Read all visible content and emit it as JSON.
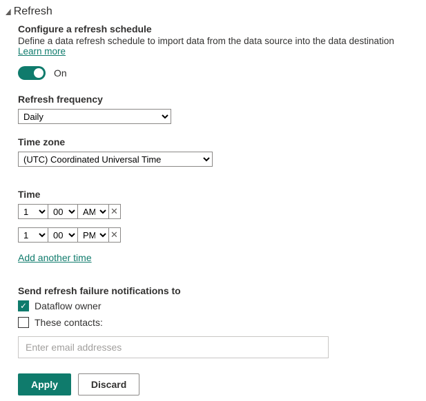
{
  "section": {
    "title": "Refresh"
  },
  "schedule": {
    "subtitle": "Configure a refresh schedule",
    "description": "Define a data refresh schedule to import data from the data source into the data destination ",
    "learn_more": "Learn more"
  },
  "toggle": {
    "state_label": "On",
    "on": true
  },
  "frequency": {
    "label": "Refresh frequency",
    "value": "Daily"
  },
  "timezone": {
    "label": "Time zone",
    "value": "(UTC) Coordinated Universal Time"
  },
  "time": {
    "label": "Time",
    "rows": [
      {
        "hour": "1",
        "minute": "00",
        "ampm": "AM"
      },
      {
        "hour": "1",
        "minute": "00",
        "ampm": "PM"
      }
    ],
    "add_label": "Add another time"
  },
  "notify": {
    "label": "Send refresh failure notifications to",
    "owner_label": "Dataflow owner",
    "owner_checked": true,
    "contacts_label": "These contacts:",
    "contacts_checked": false,
    "email_placeholder": "Enter email addresses"
  },
  "buttons": {
    "apply": "Apply",
    "discard": "Discard"
  },
  "glyphs": {
    "remove": "✕",
    "check": "✓"
  }
}
